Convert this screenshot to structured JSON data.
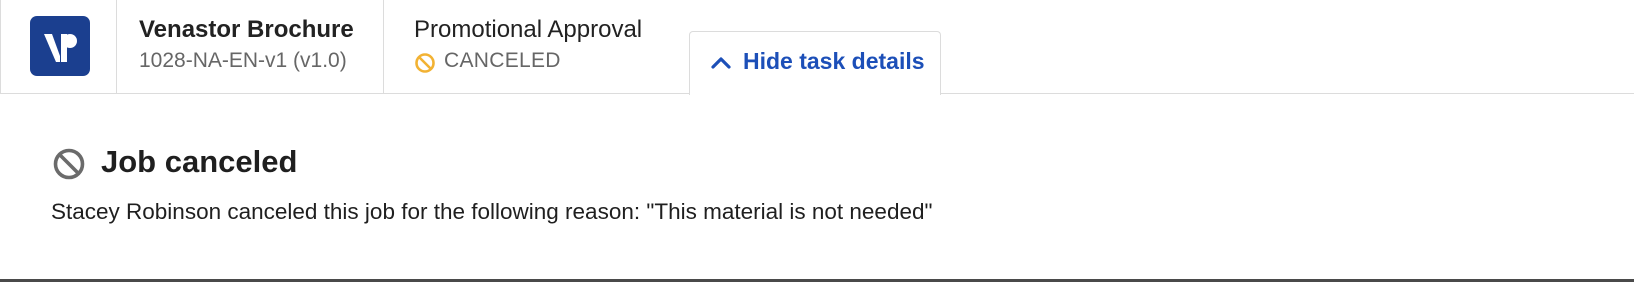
{
  "header": {
    "logo_icon": "venastor-logo-icon",
    "document": {
      "title": "Venastor Brochure",
      "code": "1028-NA-EN-v1 (v1.0)"
    },
    "workflow": {
      "name": "Promotional Approval",
      "status": "CANCELED",
      "status_icon": "canceled-icon",
      "status_color": "#f2b233"
    },
    "toggle": {
      "label": "Hide task details",
      "icon": "chevron-up-icon",
      "color": "#1c4fb8"
    }
  },
  "panel": {
    "icon": "canceled-icon",
    "title": "Job canceled",
    "message": "Stacey Robinson canceled this job for the following reason: \"This material is not needed\""
  }
}
